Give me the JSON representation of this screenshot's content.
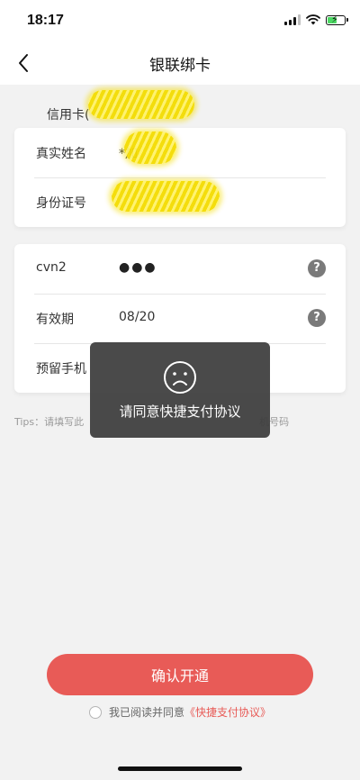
{
  "status_bar": {
    "time": "18:17",
    "battery_level": 0.6,
    "icons": [
      "signal-icon",
      "wifi-icon",
      "battery-icon"
    ]
  },
  "nav": {
    "title": "银联绑卡",
    "back_icon": "chevron-left-icon"
  },
  "card_type": {
    "label": "信用卡("
  },
  "identity": {
    "name_label": "真实姓名",
    "name_value": "*加",
    "id_label": "身份证号"
  },
  "card_info": {
    "cvn_label": "cvn2",
    "cvn_value": "●●●",
    "expiry_label": "有效期",
    "expiry_value": "08/20",
    "phone_label": "预留手机",
    "help_icon": "question-mark-icon"
  },
  "tips": {
    "left": "Tips：请填写此",
    "right": "机号码"
  },
  "toast": {
    "icon": "sad-face-icon",
    "message": "请同意快捷支付协议"
  },
  "bottom": {
    "confirm_label": "确认开通",
    "agree_text": "我已阅读并同意",
    "agree_link": "《快捷支付协议》"
  },
  "colors": {
    "accent": "#e85b57",
    "background": "#f2f2f2",
    "toast_bg": "#3c3c3c",
    "help_icon": "#7a7a7a",
    "scribble": "#f4dc00"
  }
}
